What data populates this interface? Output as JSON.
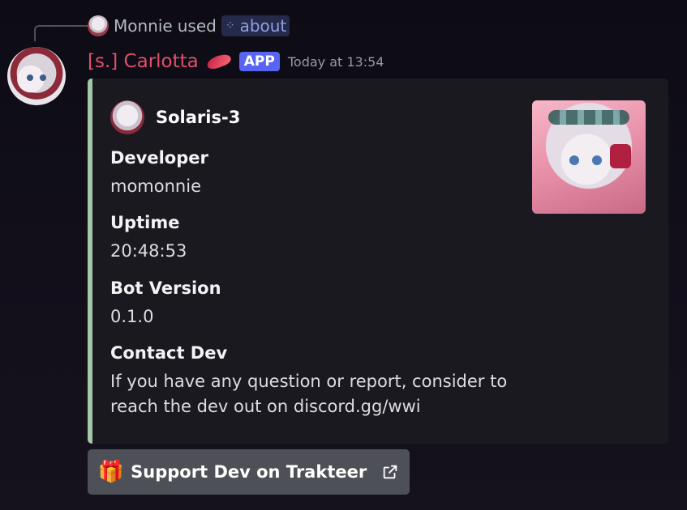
{
  "reply": {
    "user": "Monnie",
    "used_text": "used",
    "command": "about",
    "command_icon": "command-icon"
  },
  "message": {
    "username": "[s.] Carlotta",
    "username_color": "#e0506a",
    "badge": "APP",
    "timestamp": "Today at 13:54"
  },
  "embed": {
    "accent_color": "#a3c8a7",
    "author": "Solaris-3",
    "fields": [
      {
        "name": "Developer",
        "value": "momonnie"
      },
      {
        "name": "Uptime",
        "value": "20:48:53"
      },
      {
        "name": "Bot Version",
        "value": "0.1.0"
      },
      {
        "name": "Contact Dev",
        "value_line1": "If you have any question or report, consider to",
        "value_line2": "reach the dev out on discord.gg/wwi"
      }
    ]
  },
  "button": {
    "label": "Support Dev on Trakteer",
    "icon": "gift-icon",
    "trailing_icon": "external-link-icon"
  }
}
